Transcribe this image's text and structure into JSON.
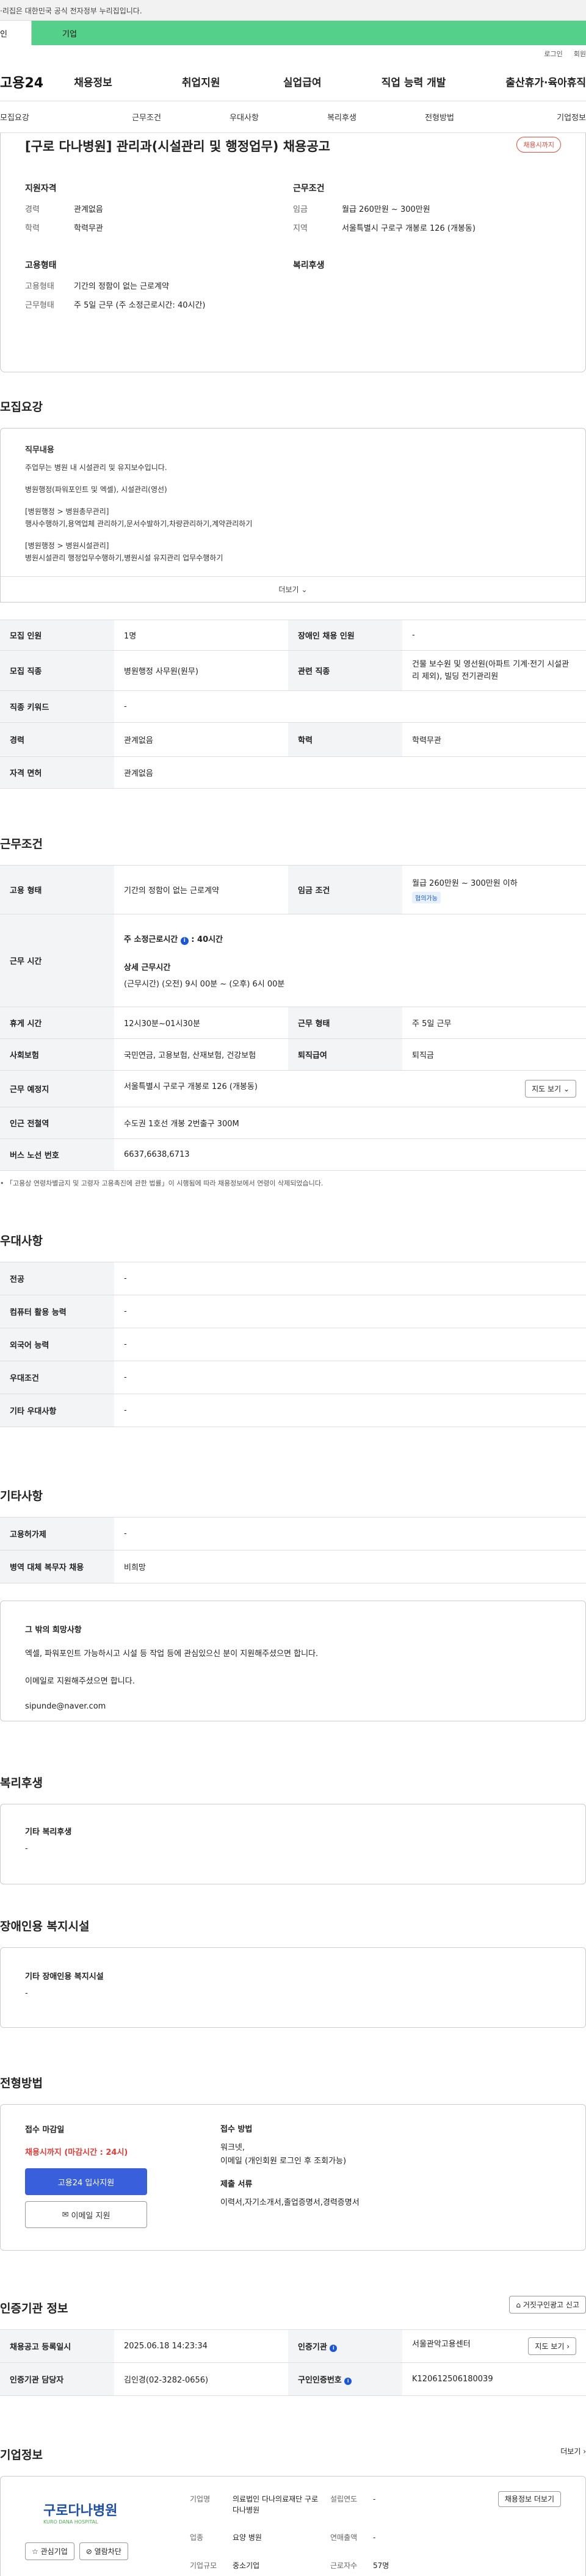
{
  "gov_banner": "·리집은 대한민국 공식 전자정부 누리집입니다.",
  "top_tabs": [
    "인",
    "기업"
  ],
  "util": [
    "로그인",
    "회원"
  ],
  "logo": "고용24",
  "gnb": [
    "채용정보",
    "취업지원",
    "실업급여",
    "직업 능력 개발",
    "출산휴가·육아휴직"
  ],
  "snb": [
    "모집요강",
    "근무조건",
    "우대사항",
    "복리후생",
    "전형방법",
    "기업정보"
  ],
  "header": {
    "title": "[구로 다나병원] 관리과(시설관리 및 행정업무) 채용공고",
    "badge": "채용시까지",
    "qual_title": "지원자격",
    "career_k": "경력",
    "career_v": "관계없음",
    "edu_k": "학력",
    "edu_v": "학력무관",
    "emp_title": "고용형태",
    "emptype_k": "고용형태",
    "emptype_v": "기간의 정함이 없는 근로계약",
    "worktype_k": "근무형태",
    "worktype_v": "주 5일 근무 (주 소정근로시간: 40시간)",
    "cond_title": "근무조건",
    "wage_k": "임금",
    "wage_v": "월급 260만원 ~ 300만원",
    "region_k": "지역",
    "region_v": "서울특별시 구로구 개봉로 126 (개봉동)",
    "welfare_title": "복리후생"
  },
  "recruit": {
    "title": "모집요강",
    "duty_title": "직무내용",
    "duty_lines": [
      "주업무는 병원 내 시설관리 및 유지보수입니다.",
      "",
      "병원행정(파워포인트 및 엑셀), 시설관리(영선)",
      "",
      "[병원행정 > 병원총무관리]",
      "행사수행하기,용역업체 관리하기,문서수발하기,차량관리하기,계약관리하기",
      "",
      "[병원행정 > 병원시설관리]",
      "병원시설관리 행정업무수행하기,병원시설 유지관리 업무수행하기"
    ],
    "more": "더보기",
    "rows": {
      "n_k": "모집 인원",
      "n_v": "1명",
      "dis_k": "장애인 채용 인원",
      "dis_v": "-",
      "job_k": "모집 직종",
      "job_v": "병원행정 사무원(원무)",
      "rel_k": "관련 직종",
      "rel_v": "건물 보수원 및 영선원(아파트 기계·전기 시설관리 제외), 빌딩 전기관리원",
      "kw_k": "직종 키워드",
      "kw_v": "-",
      "car_k": "경력",
      "car_v": "관계없음",
      "edu_k": "학력",
      "edu_v": "학력무관",
      "lic_k": "자격 면허",
      "lic_v": "관계없음"
    }
  },
  "work": {
    "title": "근무조건",
    "type_k": "고용 형태",
    "type_v": "기간의 정함이 없는 근로계약",
    "wage_k": "임금 조건",
    "wage_v": "월급 260만원 ~ 300만원 이하",
    "wage_tag": "협의가능",
    "hours_k": "근무 시간",
    "hours_1": "주 소정근로시간",
    "hours_1b": "40시간",
    "hours_2": "상세 근무시간",
    "hours_3": "(근무시간) (오전) 9시 00분 ~ (오후) 6시 00분",
    "rest_k": "휴게 시간",
    "rest_v": "12시30분~01시30분",
    "form_k": "근무 형태",
    "form_v": "주 5일 근무",
    "ins_k": "사회보험",
    "ins_v": "국민연금, 고용보험, 산재보험, 건강보험",
    "sev_k": "퇴직급여",
    "sev_v": "퇴직금",
    "place_k": "근무 예정지",
    "place_v": "서울특별시 구로구 개봉로 126 (개봉동)",
    "map": "지도 보기",
    "sub_k": "인근 전철역",
    "sub_v": "수도권 1호선 개봉 2번출구 300M",
    "bus_k": "버스 노선 번호",
    "bus_v": "6637,6638,6713",
    "note": "「고용상 연령차별금지 및 고령자 고용촉진에 관한 법률」이 시행됨에 따라 채용정보에서 연령이 삭제되었습니다."
  },
  "pref": {
    "title": "우대사항",
    "rows": [
      [
        "전공",
        "-"
      ],
      [
        "컴퓨터 활용 능력",
        "-"
      ],
      [
        "외국어 능력",
        "-"
      ],
      [
        "우대조건",
        "-"
      ],
      [
        "기타 우대사항",
        "-"
      ]
    ]
  },
  "etc": {
    "title": "기타사항",
    "rows": [
      [
        "고용허가제",
        "-"
      ],
      [
        "병역 대체 복무자 채용",
        "비희망"
      ]
    ],
    "wish_title": "그 밖의 희망사항",
    "wish_lines": [
      "엑셀, 파워포인트 가능하시고 시설 등 작업 등에 관심있으신 분이 지원해주셨으면 합니다.",
      "이메일로 지원해주셨으면 합니다.",
      "sipunde@naver.com"
    ]
  },
  "welfare": {
    "title": "복리후생",
    "sub": "기타 복리후생",
    "v": "-"
  },
  "disab": {
    "title": "장애인용 복지시설",
    "sub": "기타 장애인용 복지시설",
    "v": "-"
  },
  "screen": {
    "title": "전형방법",
    "deadline_k": "접수 마감일",
    "deadline_v": "채용시까지 (마감시간 : 24시)",
    "apply": "고용24 입사지원",
    "email": "이메일 지원",
    "method_k": "접수 방법",
    "method_v": "워크넷,\n이메일 (개인회원 로그인 후 조회가능)",
    "docs_k": "제출 서류",
    "docs_v": "이력서,자기소개서,졸업증명서,경력증명서"
  },
  "agency": {
    "title": "인증기관 정보",
    "report": "거짓구인광고 신고",
    "reg_k": "채용공고 등록일시",
    "reg_v": "2025.06.18 14:23:34",
    "org_k": "인증기관",
    "org_v": "서울관악고용센터",
    "map": "지도 보기",
    "mgr_k": "인증기관 담당자",
    "mgr_v": "김인경(02-3282-0656)",
    "no_k": "구인인증번호",
    "no_v": "K120612506180039"
  },
  "company": {
    "title": "기업정보",
    "more": "더보기",
    "logo": "구로다나병원",
    "logo_sub": "KURO DANA HOSPITAL",
    "fav": "관심기업",
    "block": "열람차단",
    "name_k": "기업명",
    "name_v": "의료법인 다나의료재단 구로다나병원",
    "est_k": "설립연도",
    "est_v": "-",
    "sales_k": "연매출액",
    "sales_v": "-",
    "ind_k": "업종",
    "ind_v": "요양 병원",
    "emp_k": "근로자수",
    "emp_v": "57명",
    "size_k": "기업규모",
    "size_v": "중소기업",
    "jobs": "채용정보 더보기"
  }
}
